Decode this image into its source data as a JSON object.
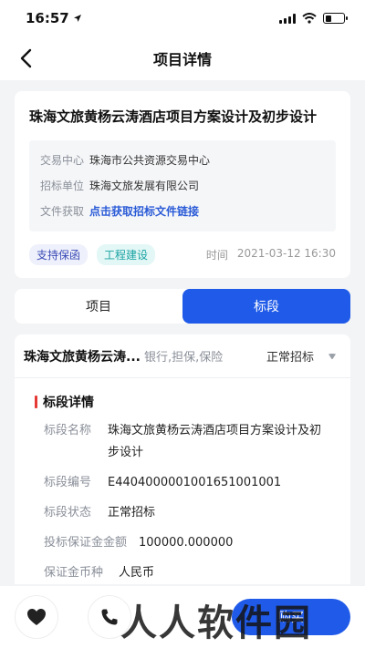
{
  "status_bar": {
    "time": "16:57"
  },
  "nav": {
    "title": "项目详情"
  },
  "project": {
    "title": "珠海文旅黄杨云涛酒店项目方案设计及初步设计",
    "info": [
      {
        "label": "交易中心",
        "value": "珠海市公共资源交易中心"
      },
      {
        "label": "招标单位",
        "value": "珠海文旅发展有限公司"
      },
      {
        "label": "文件获取",
        "value": "点击获取招标文件链接"
      }
    ],
    "tags": [
      "支持保函",
      "工程建设"
    ],
    "time_label": "时间",
    "time_value": "2021-03-12 16:30"
  },
  "tabs": [
    {
      "label": "项目",
      "active": false
    },
    {
      "label": "标段",
      "active": true
    }
  ],
  "section": {
    "name": "珠海文旅黄杨云涛...",
    "categories": "银行,担保,保险",
    "status": "正常招标",
    "detail_heading": "标段详情",
    "details": [
      {
        "label": "标段名称",
        "value": "珠海文旅黄杨云涛酒店项目方案设计及初步设计"
      },
      {
        "label": "标段编号",
        "value": "E4404000001001651001001"
      },
      {
        "label": "标段状态",
        "value": "正常招标"
      },
      {
        "label": "投标保证金金额",
        "value": "100000.000000"
      },
      {
        "label": "保证金币种",
        "value": "人民币"
      }
    ]
  },
  "bottom_bar": {
    "favorite_icon": "heart-icon",
    "phone_icon": "phone-icon",
    "action_label": "购买"
  },
  "watermark": {
    "text": "人人软件园"
  },
  "colors": {
    "accent": "#1f5ae8",
    "link": "#2a5bd7",
    "heading_bar": "#e53935"
  }
}
